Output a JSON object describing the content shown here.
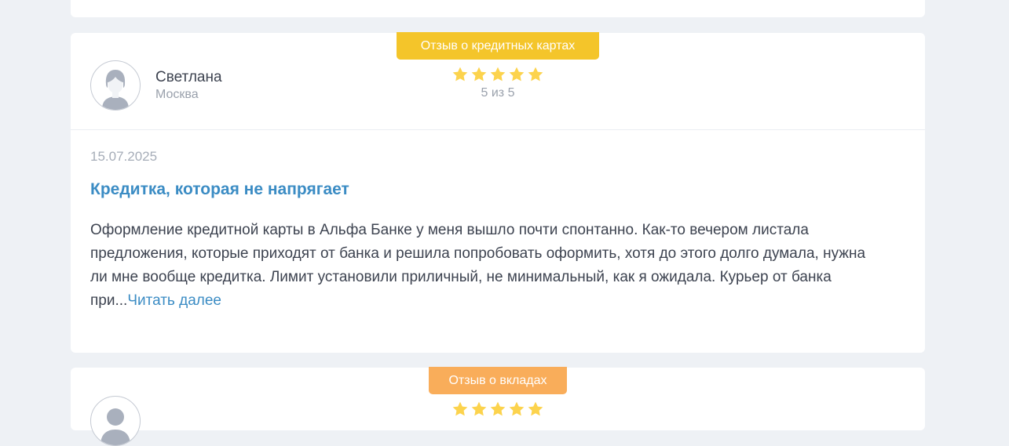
{
  "review": {
    "badge": "Отзыв о кредитных картах",
    "author_name": "Светлана",
    "author_city": "Москва",
    "rating_value": 5,
    "rating_text": "5 из 5",
    "date": "15.07.2025",
    "title": "Кредитка, которая не напрягает",
    "text": "Оформление кредитной карты в Альфа Банке у меня вышло почти спонтанно. Как-то вечером листала предложения, которые приходят от банка и решила попробовать оформить, хотя до этого долго думала, нужна ли мне вообще кредитка. Лимит установили приличный, не минимальный, как я ожидала. Курьер от банка при...",
    "read_more": "Читать далее",
    "colors": {
      "badge": "#f4c52a",
      "star": "#fcd34d",
      "link": "#3b8cc4"
    }
  },
  "next_review": {
    "badge": "Отзыв о вкладах",
    "colors": {
      "badge": "#f9ad5a"
    }
  },
  "icons": {
    "avatar": "user-silhouette-icon",
    "star": "star-icon"
  }
}
